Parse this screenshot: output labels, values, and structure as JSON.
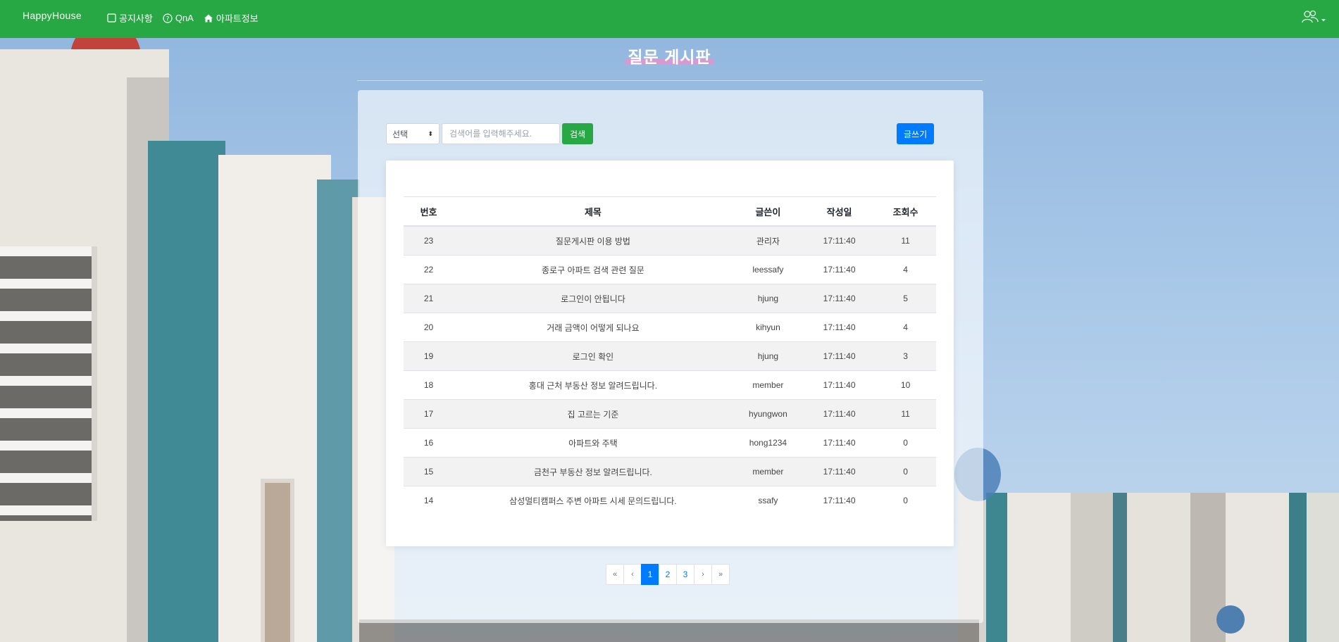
{
  "nav": {
    "brand": "HappyHouse",
    "links": [
      {
        "label": "공지사항",
        "icon": "square-icon"
      },
      {
        "label": "QnA",
        "icon": "question-circle-icon"
      },
      {
        "label": "아파트정보",
        "icon": "house-icon"
      }
    ],
    "user_icon": "users-icon"
  },
  "page": {
    "title": "질문 게시판"
  },
  "search": {
    "select_label": "선택",
    "placeholder": "검색어를 입력해주세요.",
    "search_button": "검색",
    "write_button": "글쓰기"
  },
  "table": {
    "headers": [
      "번호",
      "제목",
      "글쓴이",
      "작성일",
      "조회수"
    ],
    "rows": [
      {
        "no": "23",
        "title": "질문게시판 이용 방법",
        "author": "관리자",
        "date": "17:11:40",
        "views": "11"
      },
      {
        "no": "22",
        "title": "종로구 아파트 검색 관련 질문",
        "author": "leessafy",
        "date": "17:11:40",
        "views": "4"
      },
      {
        "no": "21",
        "title": "로그인이 안됩니다",
        "author": "hjung",
        "date": "17:11:40",
        "views": "5"
      },
      {
        "no": "20",
        "title": "거래 금액이 어떻게 되나요",
        "author": "kihyun",
        "date": "17:11:40",
        "views": "4"
      },
      {
        "no": "19",
        "title": "로그인 확인",
        "author": "hjung",
        "date": "17:11:40",
        "views": "3"
      },
      {
        "no": "18",
        "title": "홍대 근처 부동산 정보 알려드립니다.",
        "author": "member",
        "date": "17:11:40",
        "views": "10"
      },
      {
        "no": "17",
        "title": "집 고르는 기준",
        "author": "hyungwon",
        "date": "17:11:40",
        "views": "11"
      },
      {
        "no": "16",
        "title": "아파트와 주택",
        "author": "hong1234",
        "date": "17:11:40",
        "views": "0"
      },
      {
        "no": "15",
        "title": "금천구 부동산 정보 알려드립니다.",
        "author": "member",
        "date": "17:11:40",
        "views": "0"
      },
      {
        "no": "14",
        "title": "삼성멀티캠퍼스 주변 아파트 시세 문의드립니다.",
        "author": "ssafy",
        "date": "17:11:40",
        "views": "0"
      }
    ]
  },
  "pagination": {
    "first": "«",
    "prev": "‹",
    "pages": [
      "1",
      "2",
      "3"
    ],
    "active": "1",
    "next": "›",
    "last": "»"
  },
  "colors": {
    "navbar": "#28a745",
    "primary": "#007bff",
    "success": "#28a745"
  }
}
